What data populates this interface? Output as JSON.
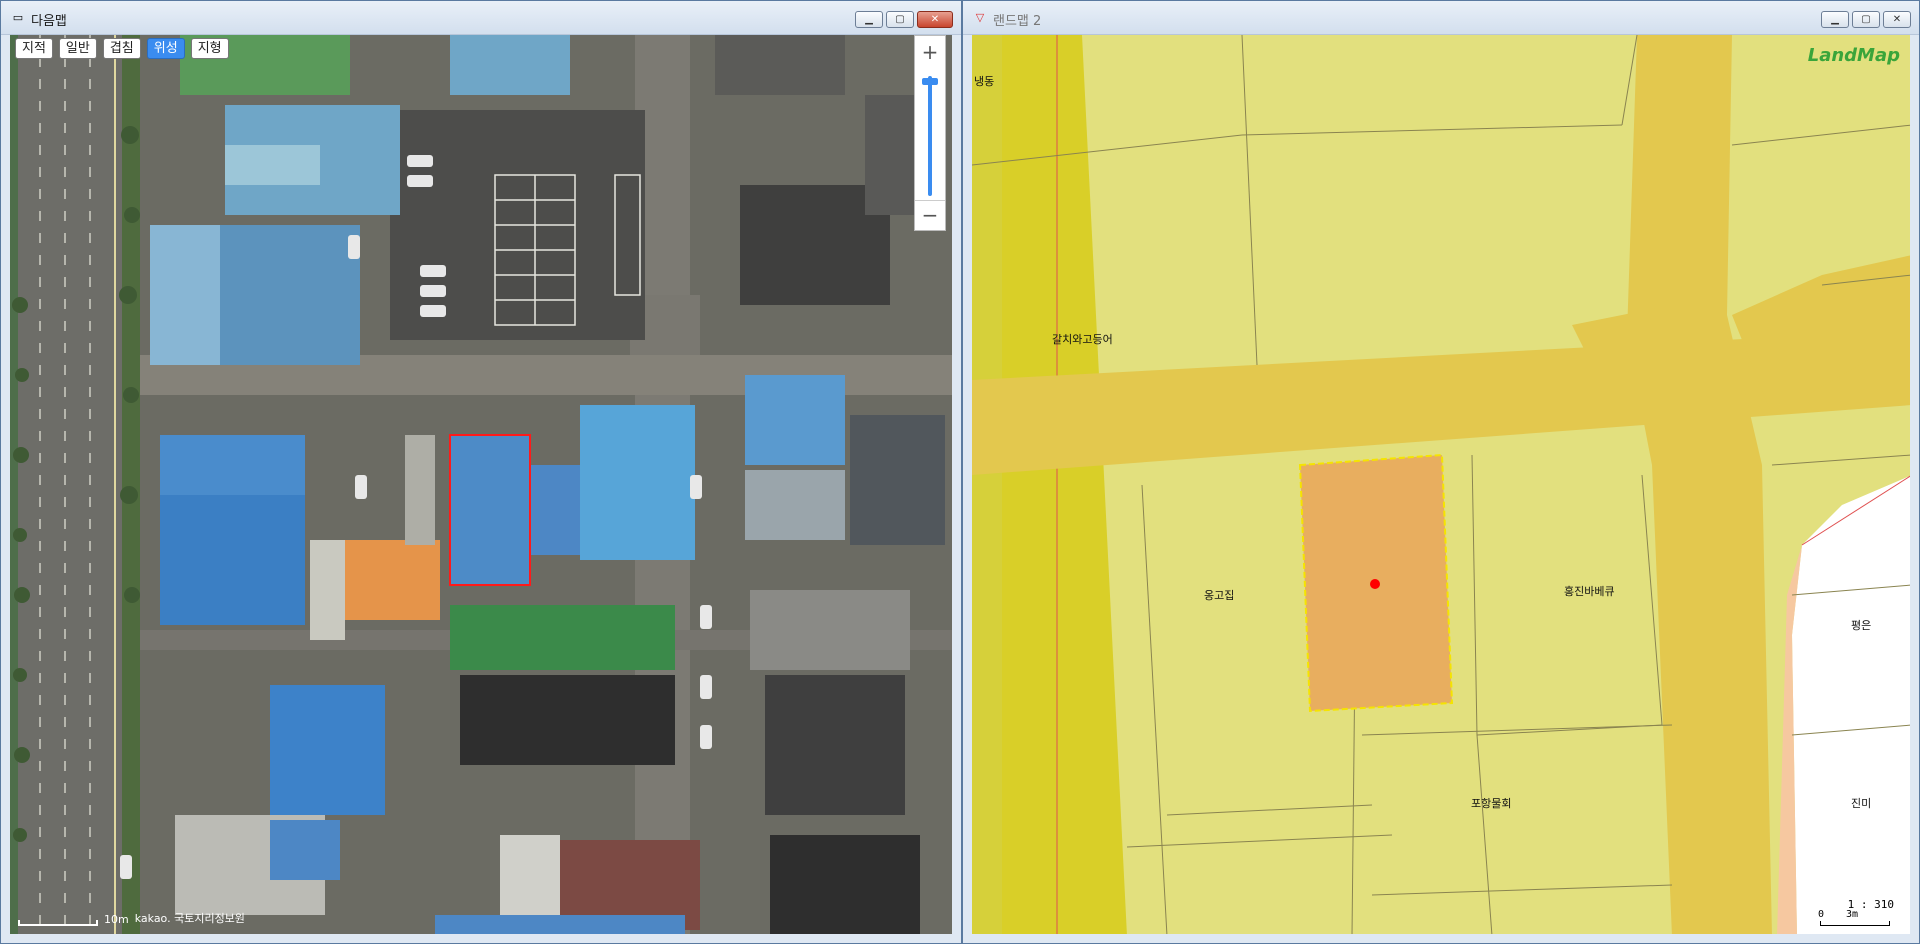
{
  "left_window": {
    "title": "다음맵",
    "map_types": [
      {
        "label": "지적",
        "active": false
      },
      {
        "label": "일반",
        "active": false
      },
      {
        "label": "겹침",
        "active": false
      },
      {
        "label": "위성",
        "active": true
      },
      {
        "label": "지형",
        "active": false
      }
    ],
    "zoom_in": "+",
    "zoom_out": "−",
    "zoom_level_fraction": 0.98,
    "scale_label": "10m",
    "attribution": "kakao. 국토지리정보원",
    "selection_color": "#ff1a1a"
  },
  "right_window": {
    "title": "랜드맵 2",
    "logo": "LandMap",
    "labels": {
      "top_left": "냉동",
      "galchi": "갈치와고등어",
      "onggojip": "옹고집",
      "hongjin": "홍진바베큐",
      "pyeongeun": "평은",
      "pohang": "포항물회",
      "jinmi": "진미"
    },
    "scale_ratio": "1 : 310",
    "scale_zero": "0",
    "scale_distance": "3m",
    "colors": {
      "parcel": "#e2e07e",
      "road": "#e3c84e",
      "selected_parcel": "#e8ae5f",
      "selected_border": "#f5e400",
      "marker": "#ff0000",
      "bank": "#ffffff"
    }
  }
}
